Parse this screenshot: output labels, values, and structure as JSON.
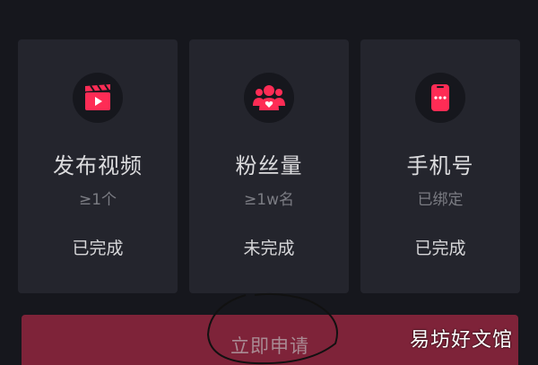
{
  "cards": [
    {
      "title": "发布视频",
      "requirement": "≥1个",
      "status": "已完成",
      "icon": "video-clapper-icon"
    },
    {
      "title": "粉丝量",
      "requirement": "≥1w名",
      "status": "未完成",
      "icon": "fans-icon"
    },
    {
      "title": "手机号",
      "requirement": "已绑定",
      "status": "已完成",
      "icon": "phone-icon"
    }
  ],
  "apply_button": {
    "label": "立即申请"
  },
  "watermark": "易坊好文馆",
  "colors": {
    "accent": "#fe2c55",
    "background": "#16171d",
    "card": "#24252d",
    "button": "#7e2339"
  }
}
